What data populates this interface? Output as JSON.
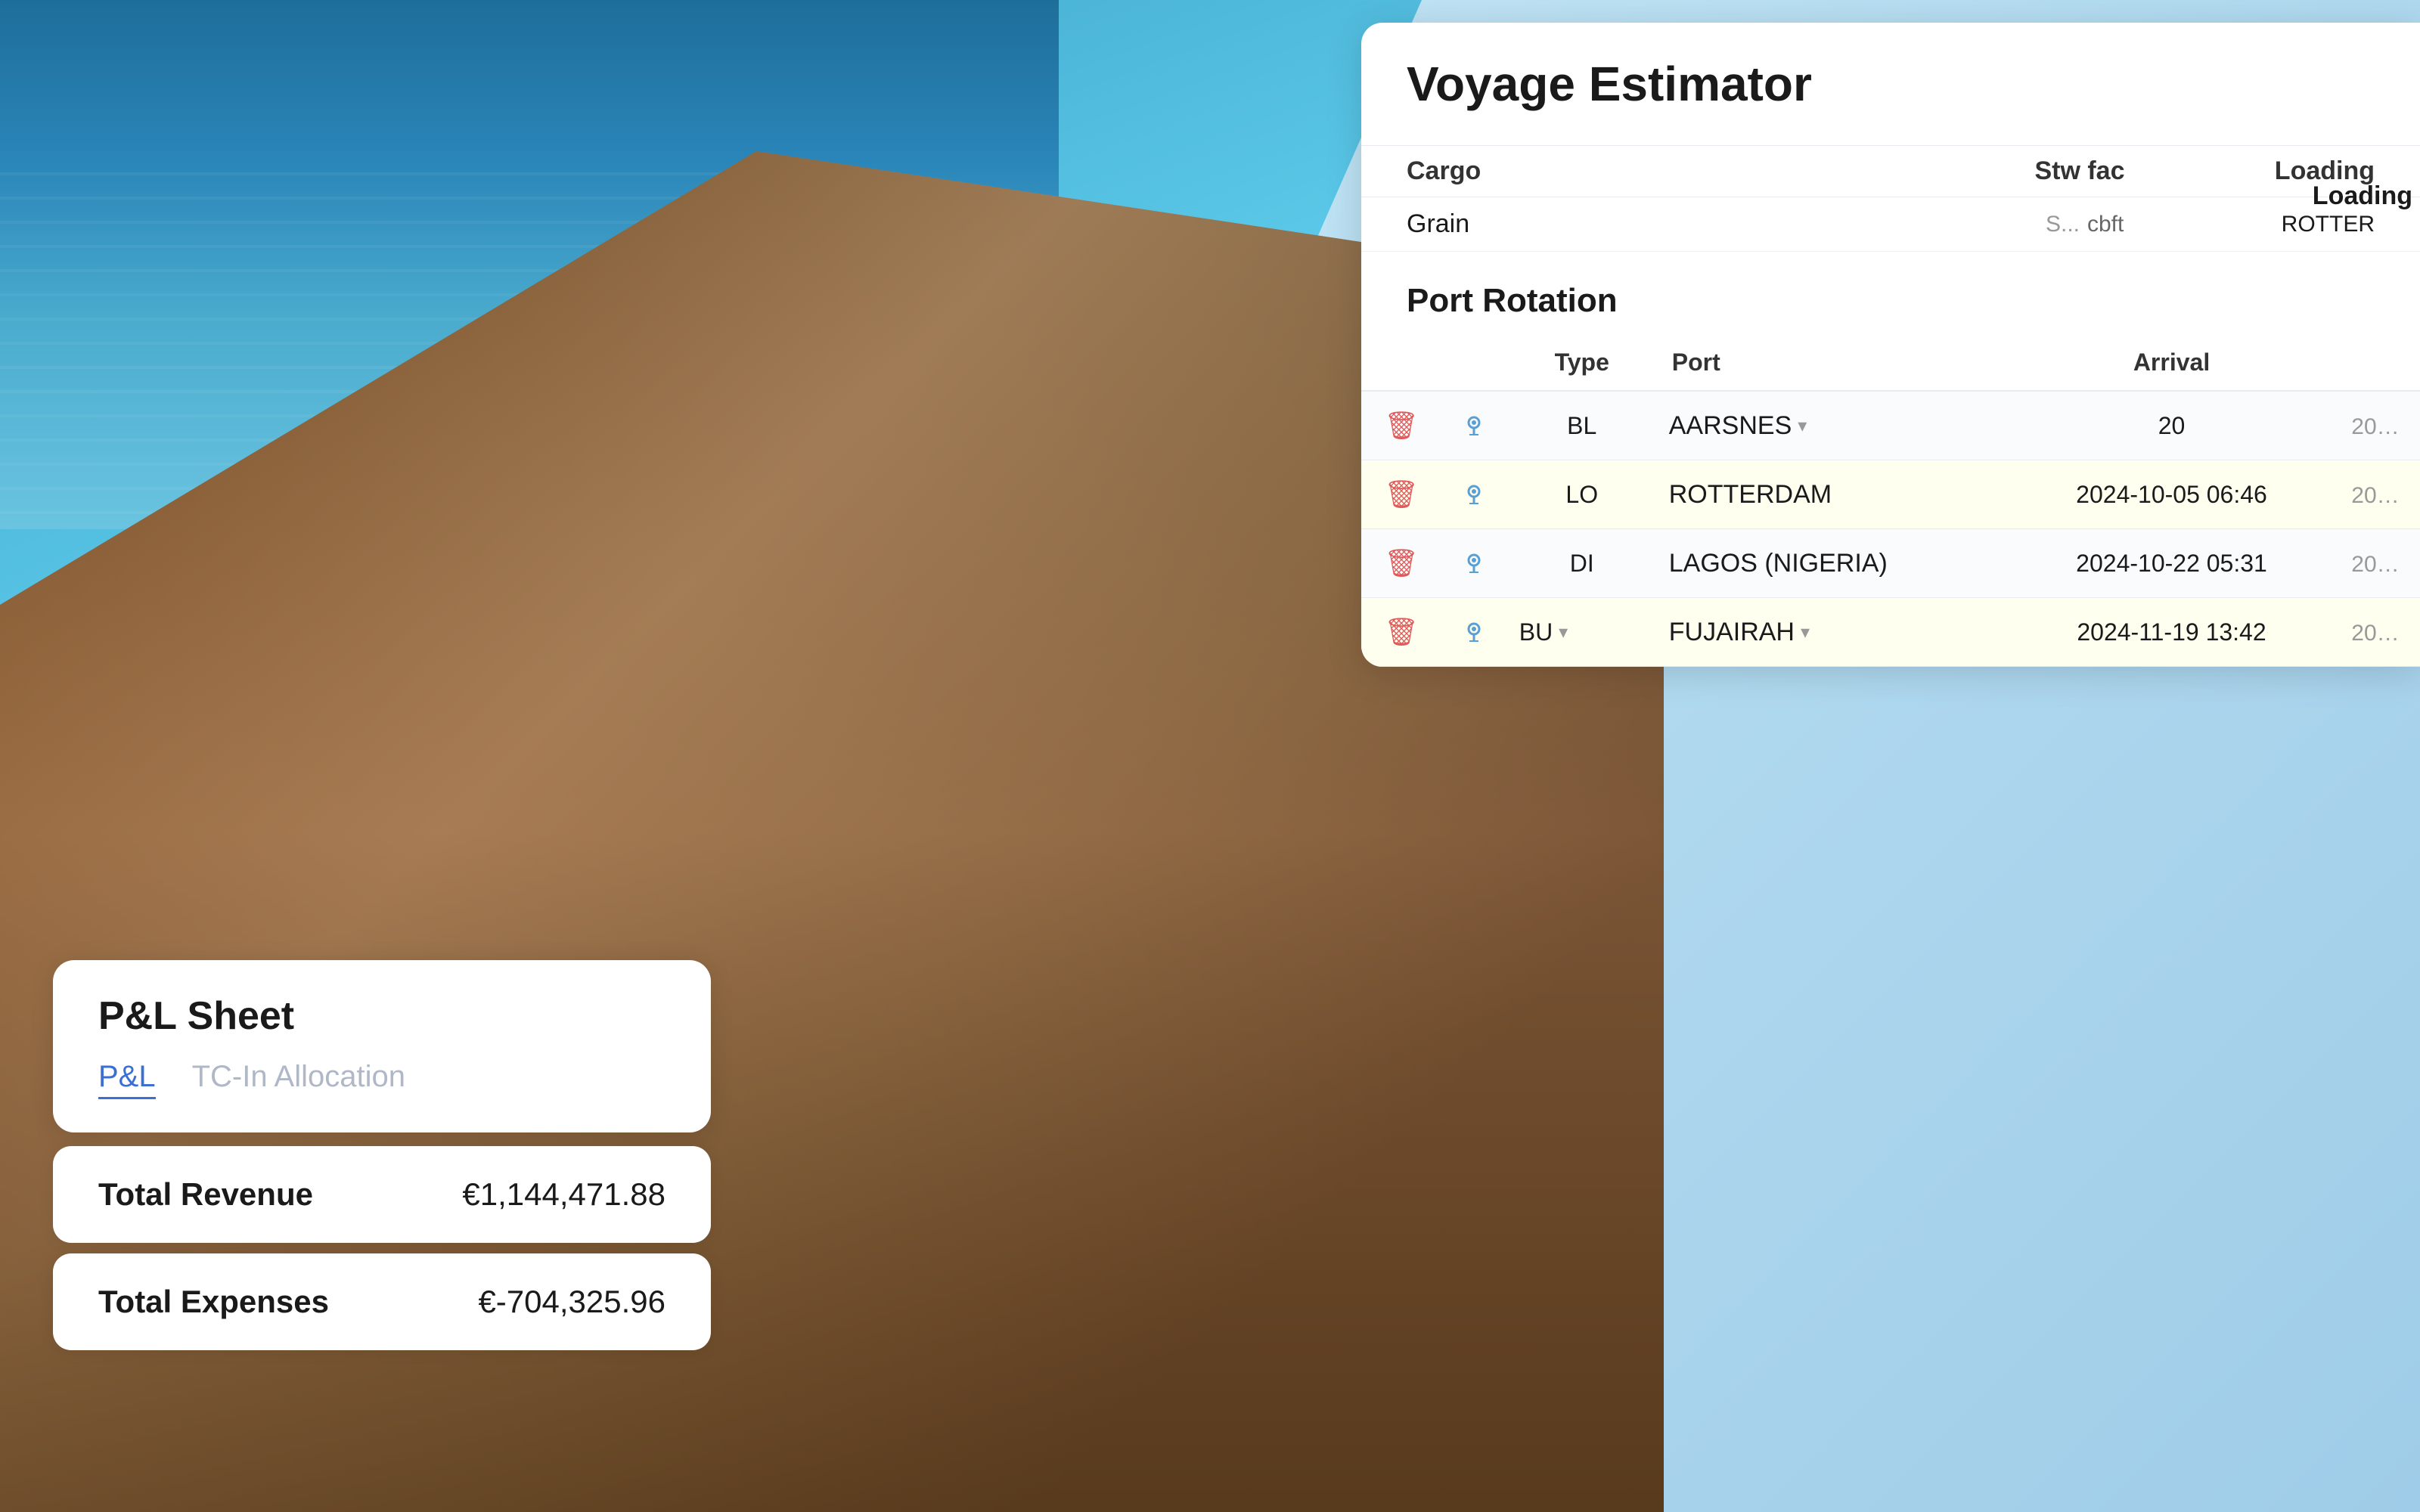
{
  "background": {
    "scene": "maritime-ocean-ship"
  },
  "voyage_estimator": {
    "title": "Voyage Estimator",
    "cargo_section": {
      "col_cargo": "Cargo",
      "col_stw_fac": "Stw fac",
      "col_loading": "Loading",
      "rows": [
        {
          "cargo": "Grain",
          "stw_fac": "S...",
          "stw_unit": "cbft",
          "loading": "ROTTER"
        }
      ]
    },
    "port_rotation": {
      "title": "Port Rotation",
      "headers": {
        "type": "Type",
        "port": "Port",
        "arrival": "Arrival"
      },
      "rows": [
        {
          "type": "BL",
          "port": "AARSNES",
          "arrival": "20",
          "has_dropdown_type": false,
          "has_dropdown_port": true,
          "row_style": "light"
        },
        {
          "type": "LO",
          "port": "ROTTERDAM",
          "arrival": "2024-10-05 06:46",
          "arrival_truncated": "20",
          "has_dropdown_type": false,
          "has_dropdown_port": false,
          "row_style": "yellow"
        },
        {
          "type": "DI",
          "port": "LAGOS (NIGERIA)",
          "arrival": "2024-10-22 05:31",
          "arrival_truncated": "20",
          "has_dropdown_type": false,
          "has_dropdown_port": false,
          "row_style": "light"
        },
        {
          "type": "BU",
          "port": "FUJAIRAH",
          "arrival": "2024-11-19 13:42",
          "arrival_truncated": "20",
          "has_dropdown_type": true,
          "has_dropdown_port": true,
          "row_style": "yellow"
        }
      ]
    }
  },
  "pnl_sheet": {
    "title": "P&L Sheet",
    "tabs": [
      {
        "label": "P&L",
        "active": true
      },
      {
        "label": "TC-In Allocation",
        "active": false
      }
    ],
    "rows": [
      {
        "label": "Total Revenue",
        "value": "€1,144,471.88"
      },
      {
        "label": "Total Expenses",
        "value": "€-704,325.96"
      }
    ]
  },
  "loading_badge": "Loading"
}
